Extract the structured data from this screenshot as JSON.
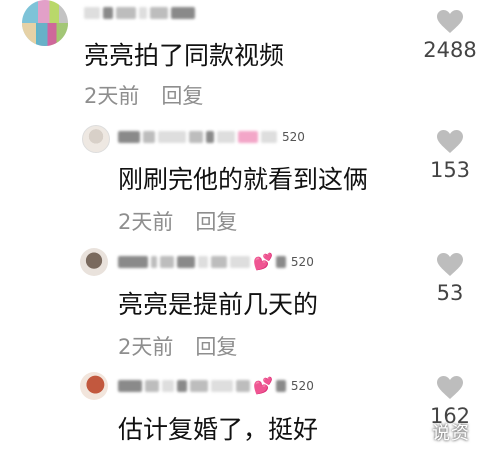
{
  "comments": [
    {
      "text": "亮亮拍了同款视频",
      "time": "2天前",
      "reply": "回复",
      "likes": "2488",
      "badge": ""
    },
    {
      "text": "刚刷完他的就看到这俩",
      "time": "2天前",
      "reply": "回复",
      "likes": "153",
      "badge": "520"
    },
    {
      "text": "亮亮是提前几天的",
      "time": "2天前",
      "reply": "回复",
      "likes": "53",
      "badge": "520"
    },
    {
      "text": "估计复婚了，挺好",
      "time": "",
      "reply": "",
      "likes": "162",
      "badge": "520"
    }
  ],
  "watermark": "说资"
}
